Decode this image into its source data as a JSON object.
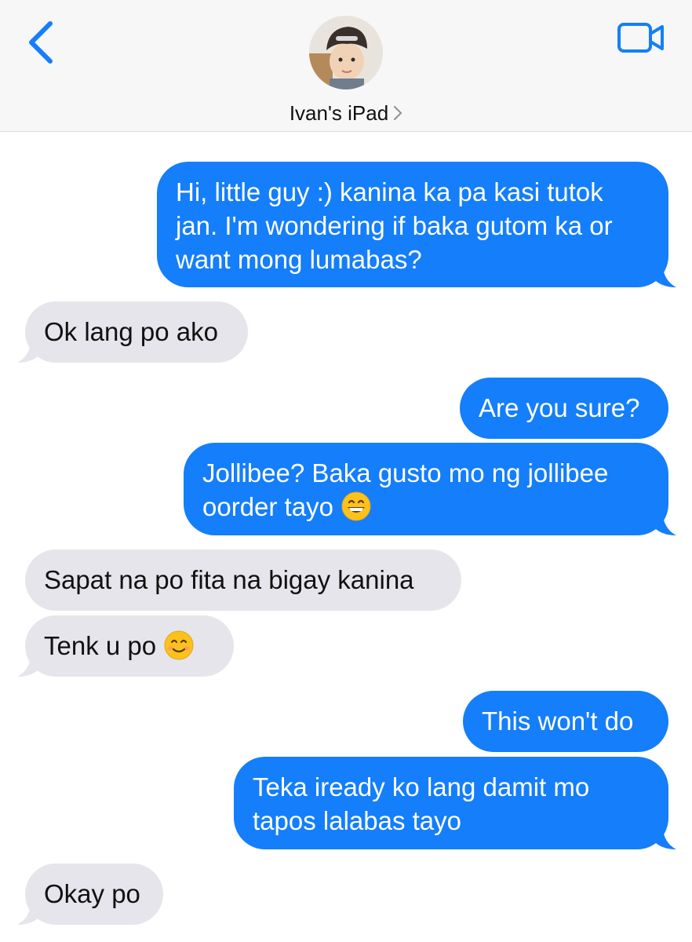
{
  "header": {
    "contact_name": "Ivan's iPad"
  },
  "colors": {
    "accent": "#147efb",
    "received_bubble": "#e6e5eb",
    "header_bg": "#f7f7f7"
  },
  "icons": {
    "back": "chevron-left-icon",
    "video": "video-camera-icon",
    "disclosure": "chevron-right-icon"
  },
  "messages": [
    {
      "from": "me",
      "text": "Hi, little guy :) kanina ka pa kasi tutok jan. I'm wondering if baka gutom ka or want mong lumabas?"
    },
    {
      "from": "them",
      "text": "Ok lang po ako"
    },
    {
      "from": "me",
      "text": "Are you sure?"
    },
    {
      "from": "me",
      "text": "Jollibee? Baka gusto mo ng jollibee oorder tayo",
      "emoji": "grinning-face-icon"
    },
    {
      "from": "them",
      "text": "Sapat na po fita na bigay kanina"
    },
    {
      "from": "them",
      "text": "Tenk u po",
      "emoji": "smiling-face-icon"
    },
    {
      "from": "me",
      "text": "This won't do"
    },
    {
      "from": "me",
      "text": "Teka iready ko lang damit mo tapos lalabas tayo"
    },
    {
      "from": "them",
      "text": "Okay po"
    }
  ]
}
